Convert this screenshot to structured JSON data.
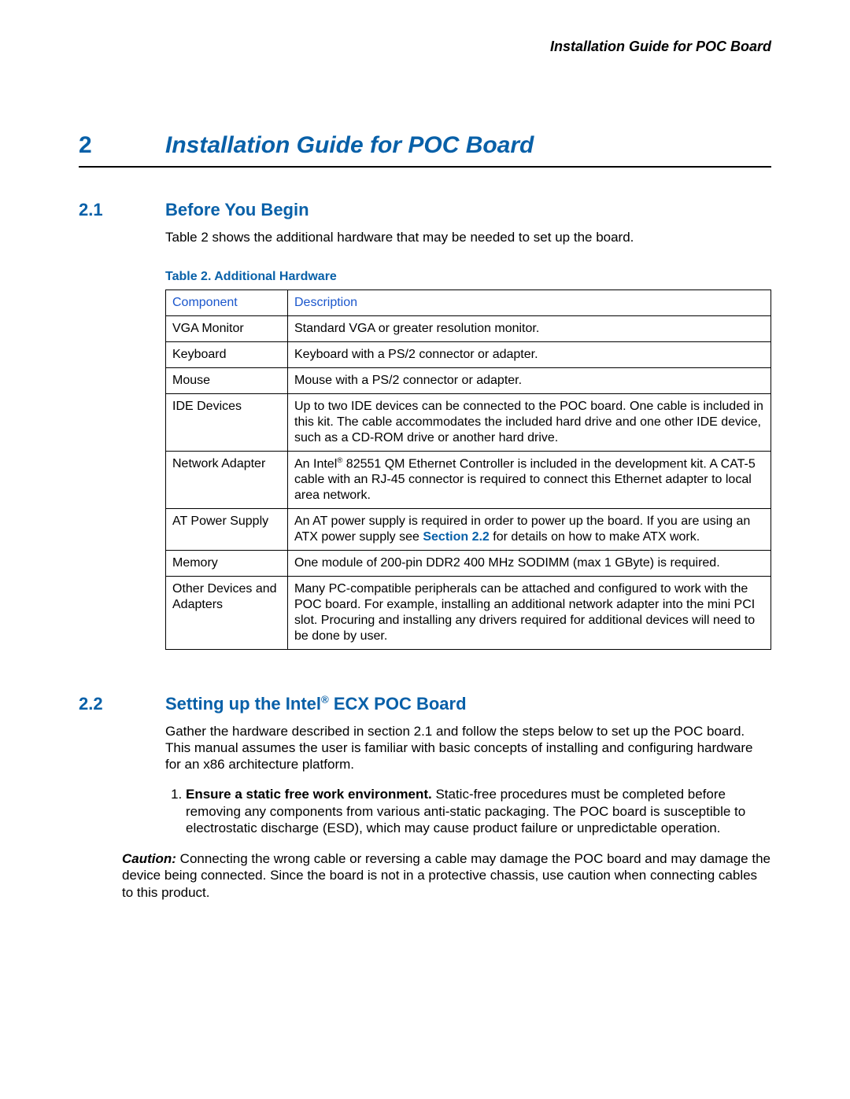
{
  "running_head": "Installation Guide for POC Board",
  "chapter": {
    "num": "2",
    "title": "Installation Guide for POC Board"
  },
  "s21": {
    "num": "2.1",
    "title": "Before You Begin",
    "intro": "Table 2 shows the additional hardware that may be needed to set up the board."
  },
  "table": {
    "caption": "Table 2. Additional Hardware",
    "headers": {
      "c1": "Component",
      "c2": "Description"
    },
    "rows": [
      {
        "c": "VGA Monitor",
        "d": "Standard VGA or greater resolution monitor."
      },
      {
        "c": "Keyboard",
        "d": "Keyboard with a PS/2 connector or adapter."
      },
      {
        "c": "Mouse",
        "d": "Mouse with a PS/2 connector or adapter."
      },
      {
        "c": "IDE Devices",
        "d": "Up to two IDE devices can be connected to the POC board. One cable is included in this kit. The cable accommodates the included hard drive and one other IDE device, such as a CD-ROM drive or another hard drive."
      },
      {
        "c": "Network Adapter",
        "d_pre": "An Intel",
        "d_post": " 82551 QM Ethernet Controller is included in the development kit. A CAT-5 cable with an RJ-45 connector is required to connect this Ethernet adapter to local area network."
      },
      {
        "c": "AT Power Supply",
        "d_pre": "An AT power supply is required in order to power up the board. If you are using an ATX power supply see ",
        "d_ref": "Section 2.2",
        "d_post": " for details on how to make ATX work."
      },
      {
        "c": "Memory",
        "d": "One module of 200-pin DDR2 400 MHz SODIMM (max 1 GByte) is required."
      },
      {
        "c": "Other Devices and Adapters",
        "d": "Many PC-compatible peripherals can be attached and configured to work with the POC board. For example, installing an additional network adapter into the mini PCI slot. Procuring and installing any drivers required for additional devices will need to be done by user."
      }
    ]
  },
  "s22": {
    "num": "2.2",
    "title_pre": "Setting up the Intel",
    "title_post": " ECX POC Board",
    "intro": "Gather the hardware described in section 2.1 and follow the steps below to set up the POC board. This manual assumes the user is familiar with basic concepts of installing and configuring hardware for an x86 architecture platform.",
    "step1_bold": "Ensure a static free work environment.",
    "step1_rest": " Static-free procedures must be completed before removing any components from various anti-static packaging. The POC board is susceptible to electrostatic discharge (ESD), which may cause product failure or unpredictable operation.",
    "caution_label": "Caution:",
    "caution_text": " Connecting the wrong cable or reversing a cable may damage the POC board and may damage the device being connected. Since the board is not in a protective chassis, use caution when connecting cables to this product."
  }
}
